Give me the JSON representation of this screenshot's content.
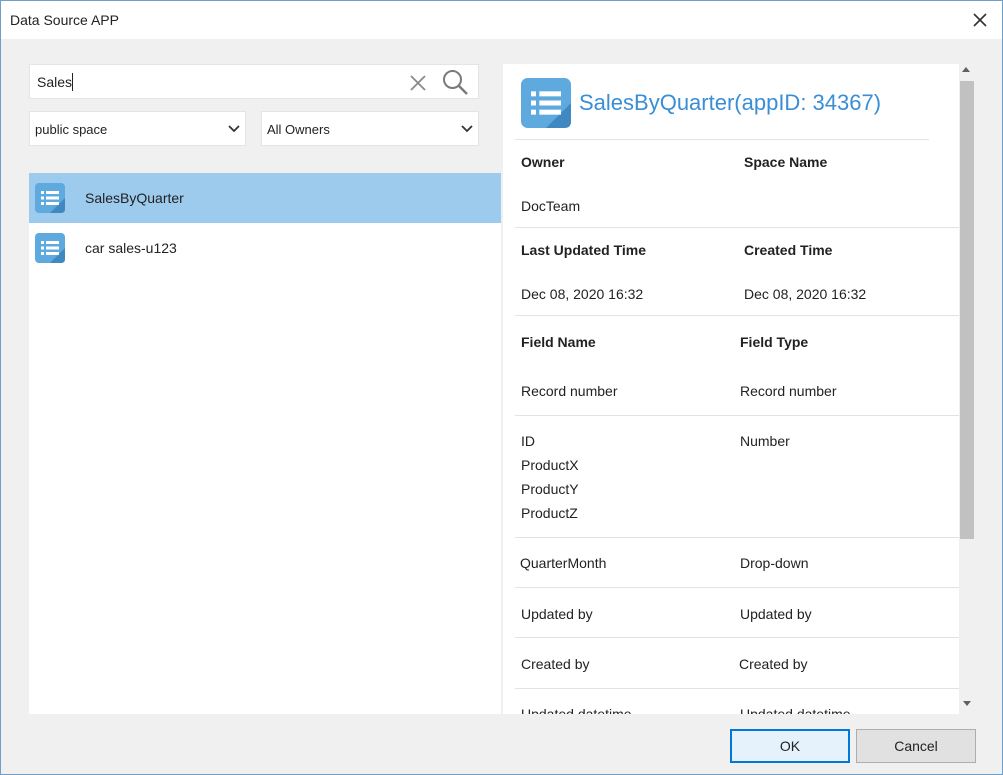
{
  "window": {
    "title": "Data Source APP"
  },
  "search": {
    "value": "Sales"
  },
  "filters": {
    "space": "public space",
    "owner": "All Owners"
  },
  "apps": [
    {
      "name": "SalesByQuarter",
      "selected": true
    },
    {
      "name": "car sales-u123",
      "selected": false
    }
  ],
  "detail": {
    "title": "SalesByQuarter(appID: 34367)",
    "owner_label": "Owner",
    "space_label": "Space Name",
    "owner_value": "DocTeam",
    "updated_label": "Last Updated Time",
    "created_label": "Created Time",
    "updated_value": "Dec 08, 2020 16:32",
    "created_value": "Dec 08, 2020 16:32",
    "field_name_label": "Field Name",
    "field_type_label": "Field Type",
    "fields": [
      {
        "name": "Record number",
        "type": "Record number"
      },
      {
        "name": "ID",
        "type": "Number"
      },
      {
        "name": "ProductX",
        "type": ""
      },
      {
        "name": "ProductY",
        "type": ""
      },
      {
        "name": "ProductZ",
        "type": ""
      },
      {
        "name": "QuarterMonth",
        "type": "Drop-down"
      },
      {
        "name": "Updated by",
        "type": "Updated by"
      },
      {
        "name": "Created by",
        "type": "Created by"
      },
      {
        "name": "Updated datetime",
        "type": "Updated datetime"
      }
    ]
  },
  "buttons": {
    "ok": "OK",
    "cancel": "Cancel"
  },
  "colors": {
    "accent": "#3a8ed6",
    "selection": "#9dcbee",
    "app_icon": "#5ea9dd"
  }
}
